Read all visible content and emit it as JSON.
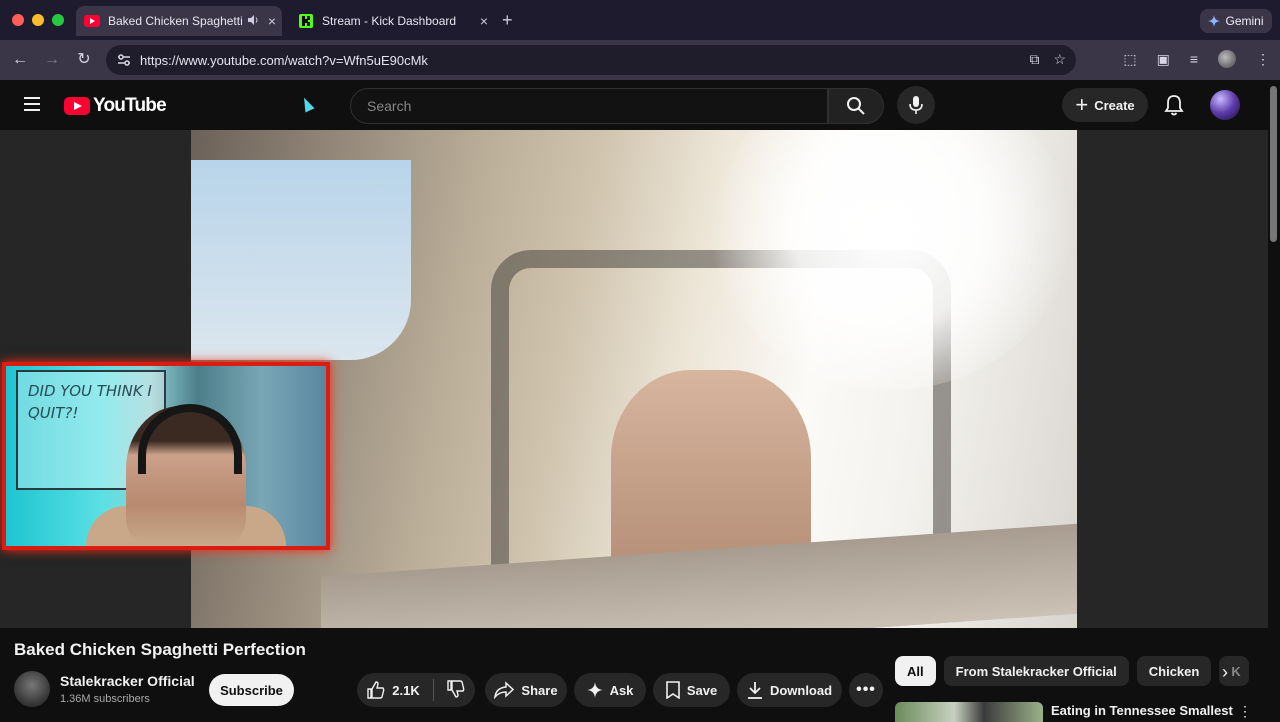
{
  "browser": {
    "tabs": [
      {
        "title": "Baked Chicken Spaghetti",
        "active": true,
        "audio": true
      },
      {
        "title": "Stream - Kick Dashboard",
        "active": false
      }
    ],
    "new_tab": "+",
    "gemini_label": "Gemini",
    "url": "https://www.youtube.com/watch?v=Wfn5uE90cMk"
  },
  "youtube": {
    "logo_text": "YouTube",
    "search_placeholder": "Search",
    "create_label": "Create"
  },
  "webcam_overlay": {
    "whiteboard_text": "DID YOU THINK I QUIT?!"
  },
  "video": {
    "title": "Baked Chicken Spaghetti Perfection",
    "channel_name": "Stalekracker Official",
    "subscribers": "1.36M subscribers",
    "subscribe_label": "Subscribe",
    "like_count": "2.1K",
    "share_label": "Share",
    "ask_label": "Ask",
    "save_label": "Save",
    "download_label": "Download"
  },
  "chips": [
    "All",
    "From Stalekracker Official",
    "Chicken",
    "K"
  ],
  "recommendation": {
    "title": "Eating in Tennessee Smallest"
  },
  "colors": {
    "yt_red": "#ff0033",
    "background": "#0f0f0f",
    "webcam_border": "#d91d12",
    "kick_green": "#53fc18"
  }
}
